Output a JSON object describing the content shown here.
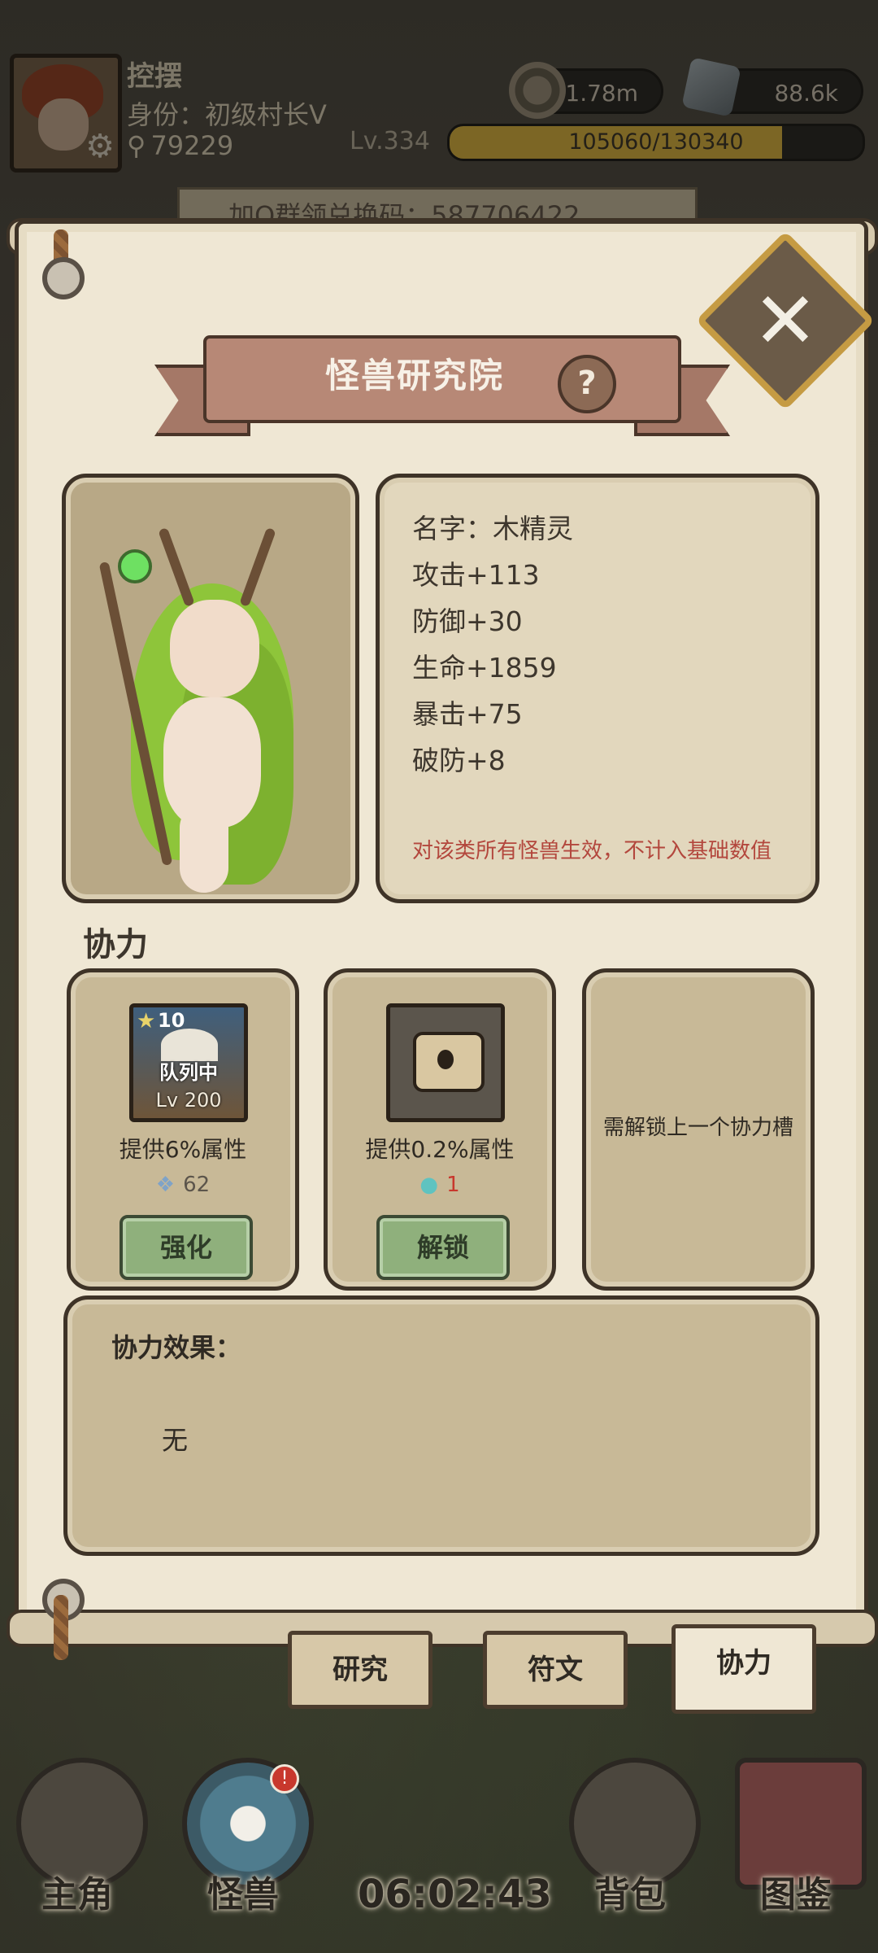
{
  "header": {
    "player_name": "控摆",
    "role": "身份：初级村长Ⅴ",
    "score": "79229",
    "coins": "21.78m",
    "ore": "88.6k",
    "level": "Lv.334",
    "xp": "105060/130340",
    "xp_fraction": 0.806
  },
  "code_bar": "加Q群领兑换码：587706422",
  "dialog": {
    "title": "怪兽研究院",
    "help_label": "?",
    "close_label": "✕",
    "stats": {
      "name": "名字：木精灵",
      "attack": "攻击+113",
      "defense": "防御+30",
      "life": "生命+1859",
      "crit": "暴击+75",
      "pierce": "破防+8",
      "note": "对该类所有怪兽生效，不计入基础数值"
    },
    "section_title": "协力",
    "slots": [
      {
        "card_stars": "10",
        "card_badge": "队列中",
        "card_level": "Lv 200",
        "desc": "提供6%属性",
        "cost": "62",
        "button": "强化"
      },
      {
        "desc": "提供0.2%属性",
        "cost": "1",
        "button": "解锁"
      },
      {
        "desc": "需解锁上一个协力槽"
      }
    ],
    "effect_title": "协力效果：",
    "effect_value": "无",
    "tabs": [
      "研究",
      "符文",
      "协力"
    ],
    "active_tab": "协力"
  },
  "nav": {
    "items": [
      "主角",
      "怪兽",
      "背包",
      "图鉴"
    ],
    "timer": "06:02:43",
    "badge_count": "!"
  },
  "colors": {
    "accent_green": "#8fb07c",
    "note_red": "#b3473d",
    "parchment": "#efe7d4"
  }
}
